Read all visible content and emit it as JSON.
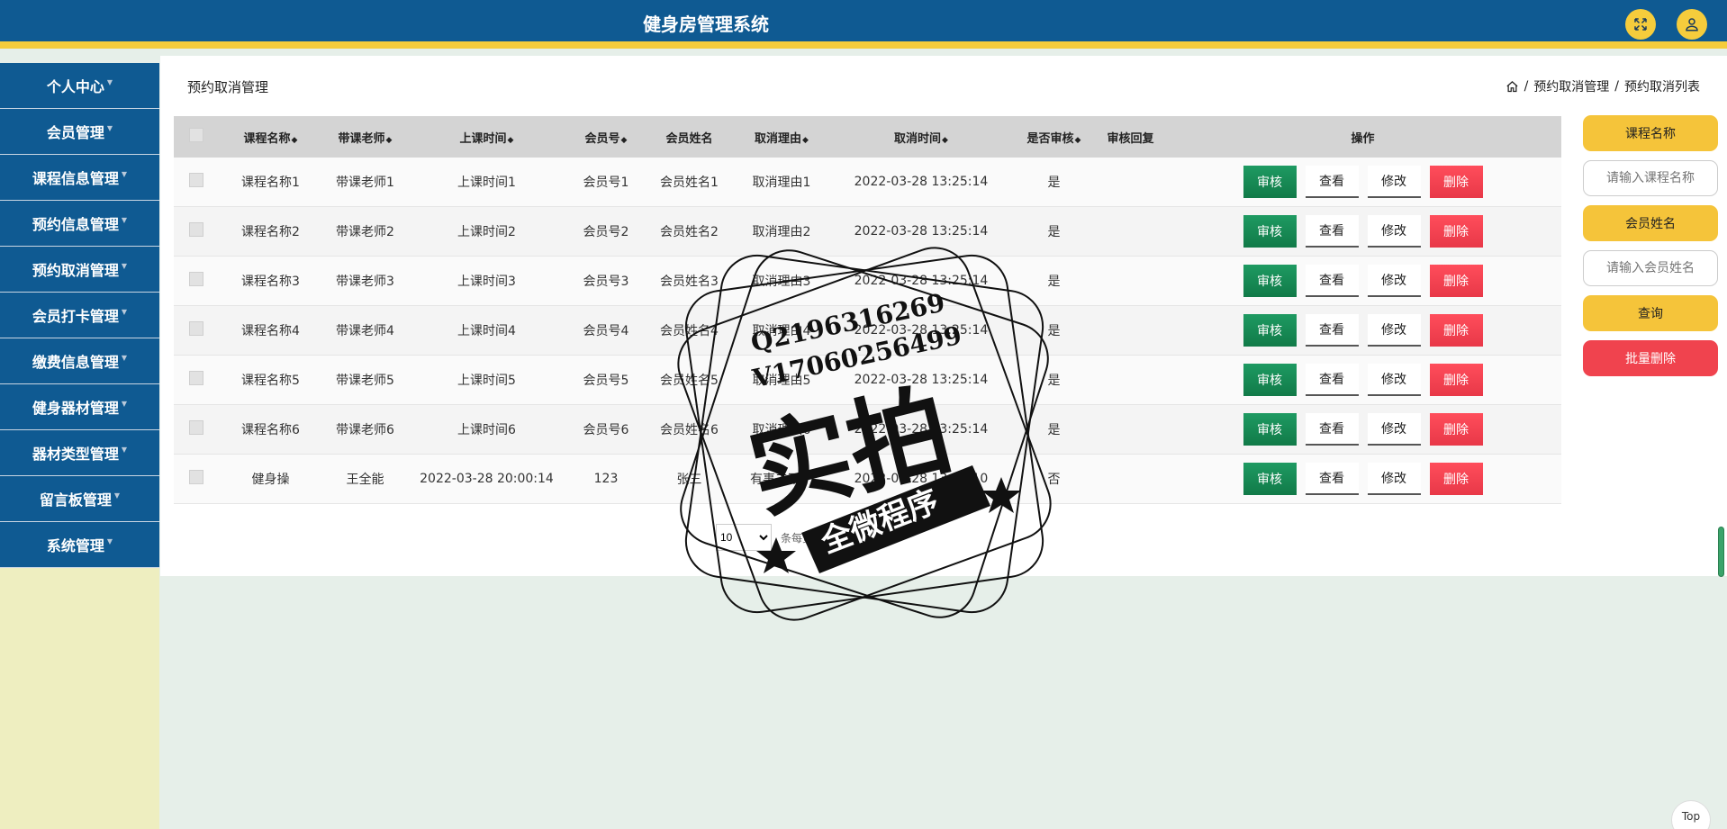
{
  "app": {
    "title": "健身房管理系统"
  },
  "top_icons": [
    "fullscreen-icon",
    "user-icon"
  ],
  "sidebar": {
    "items": [
      {
        "label": "个人中心"
      },
      {
        "label": "会员管理"
      },
      {
        "label": "课程信息管理"
      },
      {
        "label": "预约信息管理"
      },
      {
        "label": "预约取消管理"
      },
      {
        "label": "会员打卡管理"
      },
      {
        "label": "缴费信息管理"
      },
      {
        "label": "健身器材管理"
      },
      {
        "label": "器材类型管理"
      },
      {
        "label": "留言板管理"
      },
      {
        "label": "系统管理"
      }
    ]
  },
  "page": {
    "title": "预约取消管理",
    "breadcrumb": [
      "预约取消管理",
      "预约取消列表"
    ]
  },
  "table": {
    "headers": [
      "课程名称",
      "带课老师",
      "上课时间",
      "会员号",
      "会员姓名",
      "取消理由",
      "取消时间",
      "是否审核",
      "审核回复",
      "操作"
    ],
    "rows": [
      [
        "课程名称1",
        "带课老师1",
        "上课时间1",
        "会员号1",
        "会员姓名1",
        "取消理由1",
        "2022-03-28 13:25:14",
        "是",
        ""
      ],
      [
        "课程名称2",
        "带课老师2",
        "上课时间2",
        "会员号2",
        "会员姓名2",
        "取消理由2",
        "2022-03-28 13:25:14",
        "是",
        ""
      ],
      [
        "课程名称3",
        "带课老师3",
        "上课时间3",
        "会员号3",
        "会员姓名3",
        "取消理由3",
        "2022-03-28 13:25:14",
        "是",
        ""
      ],
      [
        "课程名称4",
        "带课老师4",
        "上课时间4",
        "会员号4",
        "会员姓名4",
        "取消理由4",
        "2022-03-28 13:25:14",
        "是",
        ""
      ],
      [
        "课程名称5",
        "带课老师5",
        "上课时间5",
        "会员号5",
        "会员姓名5",
        "取消理由5",
        "2022-03-28 13:25:14",
        "是",
        ""
      ],
      [
        "课程名称6",
        "带课老师6",
        "上课时间6",
        "会员号6",
        "会员姓名6",
        "取消理由6",
        "2022-03-28 13:25:14",
        "是",
        ""
      ],
      [
        "健身操",
        "王全能",
        "2022-03-28 20:00:14",
        "123",
        "张三",
        "有事去不了",
        "2022-03-28 13:34:10",
        "否",
        ""
      ]
    ],
    "actions": {
      "audit": "审核",
      "view": "查看",
      "edit": "修改",
      "delete": "删除"
    }
  },
  "pager": {
    "page_size": "10",
    "label": "条每页"
  },
  "search": {
    "course_label": "课程名称",
    "course_placeholder": "请输入课程名称",
    "member_label": "会员姓名",
    "member_placeholder": "请输入会员姓名",
    "query_label": "查询",
    "batch_delete_label": "批量删除"
  },
  "watermark": {
    "line1": "Q2196316269",
    "line2": "V17060256499",
    "main": "实拍",
    "banner": "全微程序"
  },
  "back_to_top": "Top"
}
